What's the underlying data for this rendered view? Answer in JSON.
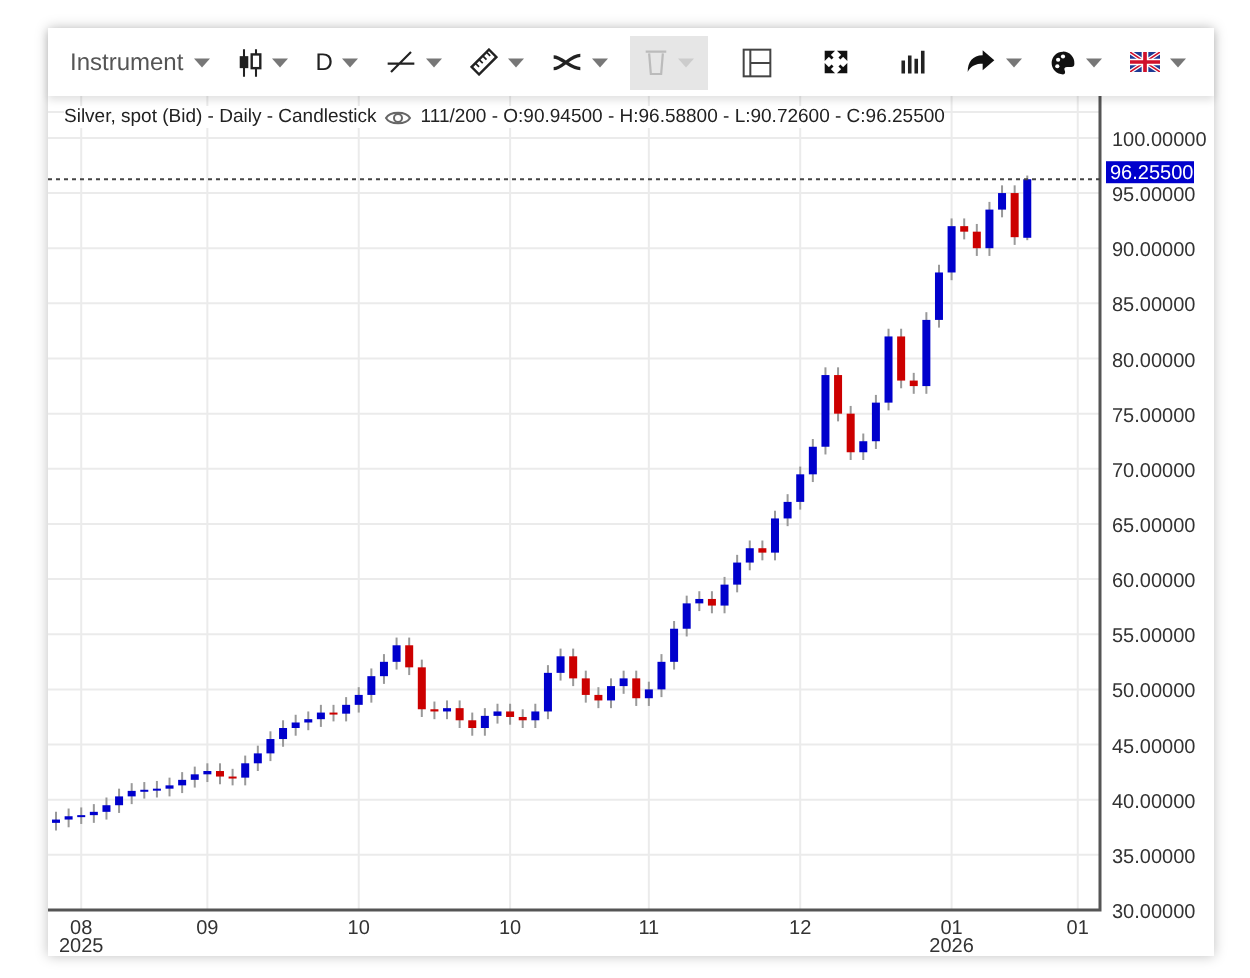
{
  "toolbar": [
    {
      "kind": "text",
      "label": "Instrument",
      "dropdown": true,
      "disabled": false
    },
    {
      "kind": "icon",
      "dropdown": true,
      "disabled": false
    },
    {
      "kind": "text",
      "label": "D",
      "dropdown": true,
      "disabled": false
    },
    {
      "kind": "icon",
      "dropdown": true,
      "disabled": false
    },
    {
      "kind": "icon",
      "dropdown": true,
      "disabled": false
    },
    {
      "kind": "icon",
      "dropdown": true,
      "disabled": false
    },
    {
      "kind": "icon",
      "dropdown": true,
      "disabled": true
    },
    {
      "kind": "icon",
      "dropdown": false,
      "disabled": false
    },
    {
      "kind": "icon",
      "dropdown": false,
      "disabled": false
    },
    {
      "kind": "icon",
      "dropdown": false,
      "disabled": false
    },
    {
      "kind": "icon",
      "dropdown": true,
      "disabled": false
    },
    {
      "kind": "icon",
      "dropdown": true,
      "disabled": false
    },
    {
      "kind": "icon",
      "dropdown": true,
      "disabled": false
    }
  ],
  "chart": {
    "title": "Silver, spot (Bid) - Daily - Candlestick",
    "info": "111/200 - O:90.94500 - H:96.58800 - L:90.72600 - C:96.25500",
    "chart_data": {
      "type": "candlestick",
      "grid": true,
      "ylim": [
        30,
        103.8
      ],
      "categories": [
        null,
        null,
        "08\n2025",
        null,
        null,
        null,
        null,
        null,
        null,
        null,
        null,
        null,
        "09",
        null,
        null,
        null,
        null,
        null,
        null,
        null,
        null,
        null,
        null,
        null,
        "10",
        null,
        null,
        null,
        null,
        null,
        null,
        null,
        null,
        null,
        null,
        null,
        "10",
        null,
        null,
        null,
        null,
        null,
        null,
        null,
        null,
        null,
        null,
        "11",
        null,
        null,
        null,
        null,
        null,
        null,
        null,
        null,
        null,
        null,
        null,
        "12",
        null,
        null,
        null,
        null,
        null,
        null,
        null,
        null,
        null,
        null,
        null,
        "01\n2026",
        null,
        null,
        null,
        null,
        null,
        null,
        null,
        null,
        null,
        "01"
      ],
      "yticks": [
        {
          "value": 100,
          "label": "100.00000"
        },
        {
          "value": 95,
          "label": "95.00000"
        },
        {
          "value": 90,
          "label": "90.00000"
        },
        {
          "value": 85,
          "label": "85.00000"
        },
        {
          "value": 80,
          "label": "80.00000"
        },
        {
          "value": 75,
          "label": "75.00000"
        },
        {
          "value": 70,
          "label": "70.00000"
        },
        {
          "value": 65,
          "label": "65.00000"
        },
        {
          "value": 60,
          "label": "60.00000"
        },
        {
          "value": 55,
          "label": "55.00000"
        },
        {
          "value": 50,
          "label": "50.00000"
        },
        {
          "value": 45,
          "label": "45.00000"
        },
        {
          "value": 40,
          "label": "40.00000"
        },
        {
          "value": 35,
          "label": "35.00000"
        },
        {
          "value": 30,
          "label": "30.00000"
        }
      ],
      "ref_lines": [
        {
          "axis": "y",
          "value": 96.255,
          "label": "96.25500"
        }
      ],
      "ohlc": [
        [
          37.9,
          38.9,
          37.2,
          38.2
        ],
        [
          38.2,
          39.2,
          37.5,
          38.5
        ],
        [
          38.5,
          39.3,
          37.8,
          38.6
        ],
        [
          38.6,
          39.6,
          37.9,
          38.9
        ],
        [
          38.9,
          40.2,
          38.2,
          39.5
        ],
        [
          39.5,
          41.0,
          38.8,
          40.3
        ],
        [
          40.3,
          41.5,
          39.6,
          40.8
        ],
        [
          40.8,
          41.6,
          40.1,
          40.9
        ],
        [
          40.9,
          41.7,
          40.2,
          41.0
        ],
        [
          41.0,
          42.0,
          40.3,
          41.3
        ],
        [
          41.3,
          42.5,
          40.6,
          41.8
        ],
        [
          41.8,
          43.0,
          41.1,
          42.3
        ],
        [
          42.3,
          43.3,
          41.6,
          42.6
        ],
        [
          42.6,
          43.3,
          41.4,
          42.1
        ],
        [
          42.1,
          42.8,
          41.3,
          42.0
        ],
        [
          42.0,
          44.0,
          41.3,
          43.3
        ],
        [
          43.3,
          44.9,
          42.6,
          44.2
        ],
        [
          44.2,
          46.2,
          43.5,
          45.5
        ],
        [
          45.5,
          47.2,
          44.8,
          46.5
        ],
        [
          46.5,
          47.7,
          45.8,
          47.0
        ],
        [
          47.0,
          48.0,
          46.3,
          47.3
        ],
        [
          47.3,
          48.6,
          46.6,
          47.9
        ],
        [
          47.9,
          48.6,
          47.1,
          47.8
        ],
        [
          47.8,
          49.3,
          47.1,
          48.6
        ],
        [
          48.6,
          50.2,
          47.9,
          49.5
        ],
        [
          49.5,
          51.9,
          48.8,
          51.2
        ],
        [
          51.2,
          53.2,
          50.5,
          52.5
        ],
        [
          52.5,
          54.7,
          51.8,
          54.0
        ],
        [
          54.0,
          54.7,
          51.3,
          52.0
        ],
        [
          52.0,
          52.7,
          47.5,
          48.2
        ],
        [
          48.2,
          48.9,
          47.3,
          48.0
        ],
        [
          48.0,
          49.0,
          47.3,
          48.3
        ],
        [
          48.3,
          49.0,
          46.5,
          47.2
        ],
        [
          47.2,
          47.9,
          45.8,
          46.5
        ],
        [
          46.5,
          48.3,
          45.8,
          47.6
        ],
        [
          47.6,
          48.7,
          46.9,
          48.0
        ],
        [
          48.0,
          48.7,
          46.8,
          47.5
        ],
        [
          47.5,
          48.2,
          46.5,
          47.2
        ],
        [
          47.2,
          48.7,
          46.5,
          48.0
        ],
        [
          48.0,
          52.2,
          47.3,
          51.5
        ],
        [
          51.5,
          53.7,
          50.8,
          53.0
        ],
        [
          53.0,
          53.7,
          50.3,
          51.0
        ],
        [
          51.0,
          51.7,
          48.8,
          49.5
        ],
        [
          49.5,
          50.2,
          48.3,
          49.0
        ],
        [
          49.0,
          51.0,
          48.3,
          50.3
        ],
        [
          50.3,
          51.7,
          49.6,
          51.0
        ],
        [
          51.0,
          51.7,
          48.5,
          49.2
        ],
        [
          49.2,
          50.7,
          48.5,
          50.0
        ],
        [
          50.0,
          53.2,
          49.3,
          52.5
        ],
        [
          52.5,
          56.2,
          51.8,
          55.5
        ],
        [
          55.5,
          58.5,
          54.8,
          57.8
        ],
        [
          57.8,
          58.9,
          57.1,
          58.2
        ],
        [
          58.2,
          58.9,
          56.9,
          57.6
        ],
        [
          57.6,
          60.2,
          56.9,
          59.5
        ],
        [
          59.5,
          62.2,
          58.8,
          61.5
        ],
        [
          61.5,
          63.5,
          60.8,
          62.8
        ],
        [
          62.8,
          63.5,
          61.7,
          62.4
        ],
        [
          62.4,
          66.2,
          61.7,
          65.5
        ],
        [
          65.5,
          67.7,
          64.8,
          67.0
        ],
        [
          67.0,
          70.2,
          66.3,
          69.5
        ],
        [
          69.5,
          72.7,
          68.8,
          72.0
        ],
        [
          72.0,
          79.2,
          71.3,
          78.5
        ],
        [
          78.5,
          79.2,
          74.3,
          75.0
        ],
        [
          75.0,
          75.7,
          70.8,
          71.5
        ],
        [
          71.5,
          73.2,
          70.8,
          72.5
        ],
        [
          72.5,
          76.7,
          71.8,
          76.0
        ],
        [
          76.0,
          82.7,
          75.3,
          82.0
        ],
        [
          82.0,
          82.7,
          77.3,
          78.0
        ],
        [
          78.0,
          78.7,
          76.8,
          77.5
        ],
        [
          77.5,
          84.2,
          76.8,
          83.5
        ],
        [
          83.5,
          88.5,
          82.8,
          87.8
        ],
        [
          87.8,
          92.7,
          87.1,
          92.0
        ],
        [
          92.0,
          92.7,
          90.8,
          91.5
        ],
        [
          91.5,
          92.2,
          89.3,
          90.0
        ],
        [
          90.0,
          94.2,
          89.3,
          93.5
        ],
        [
          93.5,
          95.7,
          92.8,
          95.0
        ],
        [
          95.0,
          95.7,
          90.3,
          91.0
        ],
        [
          90.945,
          96.588,
          90.726,
          96.255
        ],
        null,
        null,
        null,
        null
      ]
    }
  }
}
